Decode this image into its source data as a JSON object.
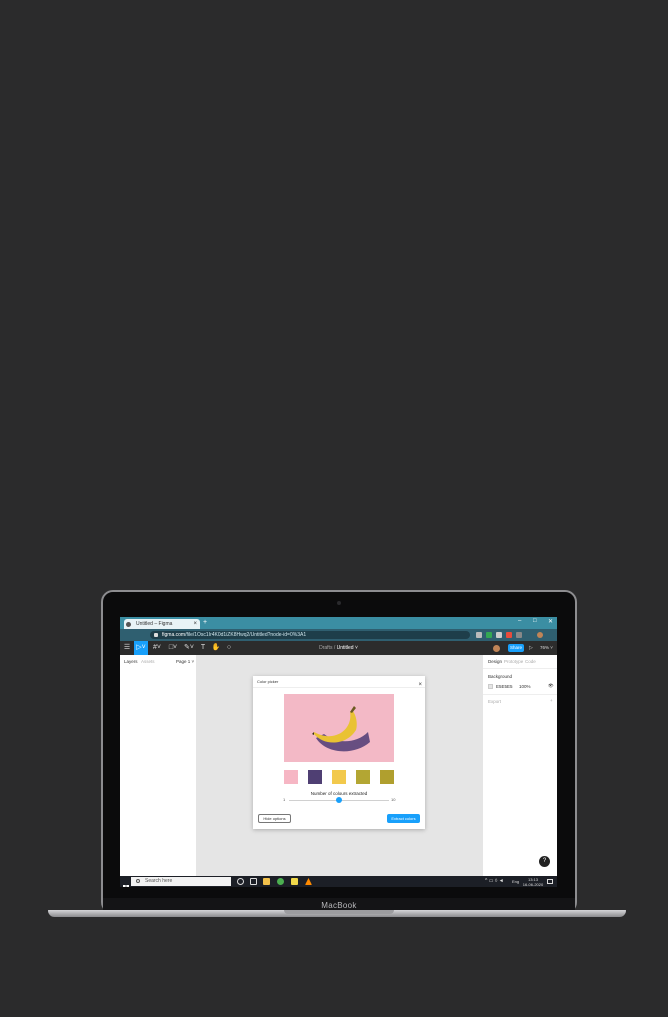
{
  "device": {
    "brand_label": "MacBook"
  },
  "browser": {
    "tab_title": "Untitled – Figma",
    "tab_close": "×",
    "new_tab": "+",
    "url_domain": "figma.com",
    "url_path": "/file/1Osc1Ir4K0d1iZK8Hwq2/Untitled?node-id=0%3A1",
    "window_controls": [
      "–",
      "□",
      "✕"
    ]
  },
  "figma": {
    "breadcrumb_parent": "Drafts",
    "breadcrumb_sep": " / ",
    "file_name": "Untitled ˅",
    "share_label": "Share",
    "play_glyph": "▷",
    "zoom": "76% ˅",
    "tools": [
      "☰",
      "▷˅",
      "#˅",
      "□˅",
      "✎˅",
      "T",
      "✋",
      "○"
    ],
    "left_panel": {
      "tab_layers": "Layers",
      "tab_assets": "Assets",
      "page": "Page 1 ˅"
    },
    "right_panel": {
      "tab_design": "Design",
      "tab_prototype": "Prototype",
      "tab_code": "Code",
      "section_background": "Background",
      "bg_hex": "E5E5E5",
      "bg_opacity": "100%",
      "section_export": "Export",
      "add_glyph": "+",
      "eye_glyph": "👁"
    },
    "help_glyph": "?"
  },
  "plugin": {
    "title": "Color picker",
    "close": "×",
    "swatches": [
      "#f6b6c4",
      "#4f3f73",
      "#f2c94c",
      "#b3a633",
      "#b09f2e"
    ],
    "slider_label": "Number of colours extracted",
    "slider_min": "1",
    "slider_max": "10",
    "slider_value": 5,
    "hide_button": "Hide options",
    "extract_button": "Extract colors"
  },
  "taskbar": {
    "search_placeholder": "Search here",
    "tray_lang": "Eng",
    "time": "13:13",
    "date": "16-06-2020"
  },
  "colors": {
    "figma_blue": "#18a0fb",
    "chrome_teal": "#3b8ea3"
  }
}
